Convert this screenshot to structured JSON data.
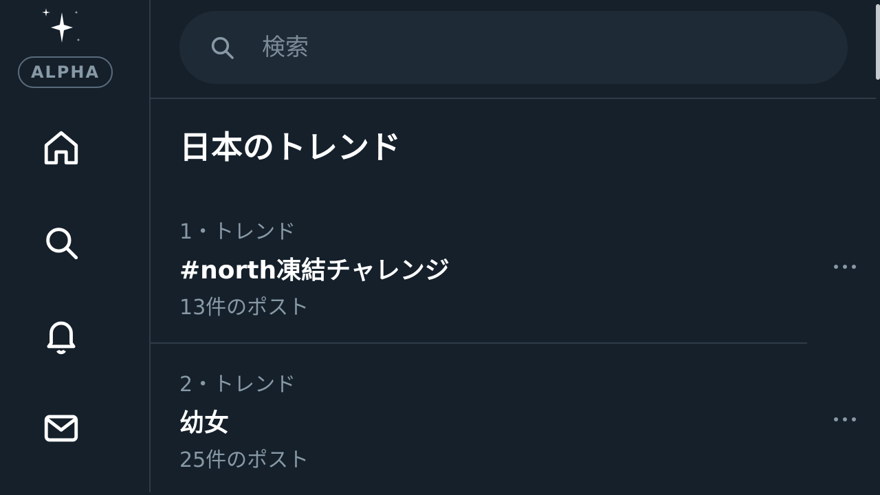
{
  "sidebar": {
    "badge": "ALPHA",
    "logo_icon": "sparkle-icon",
    "items": [
      {
        "icon": "home-icon"
      },
      {
        "icon": "search-icon"
      },
      {
        "icon": "bell-icon"
      },
      {
        "icon": "mail-icon"
      }
    ]
  },
  "search": {
    "placeholder": "検索",
    "icon": "search-icon"
  },
  "trends": {
    "title": "日本のトレンド",
    "items": [
      {
        "meta": "1・トレンド",
        "name": "#north凍結チャレンジ",
        "count": "13件のポスト"
      },
      {
        "meta": "2・トレンド",
        "name": "幼女",
        "count": "25件のポスト"
      }
    ]
  },
  "colors": {
    "background": "#15202b",
    "search_bg": "#1e2a36",
    "muted_text": "#8899a6",
    "divider": "#2f3b47"
  }
}
